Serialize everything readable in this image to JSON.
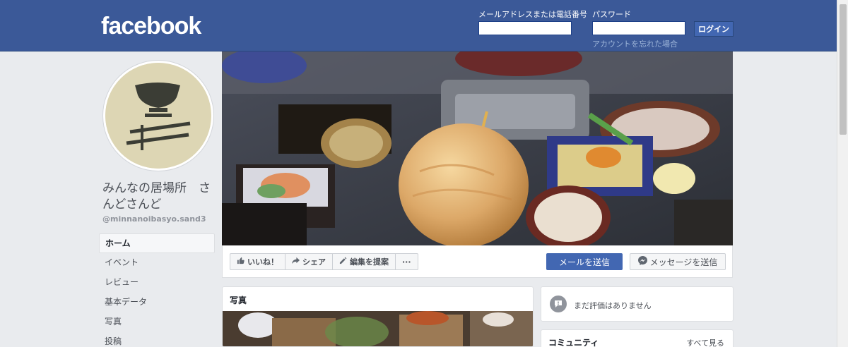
{
  "header": {
    "logo": "facebook",
    "email_label": "メールアドレスまたは電話番号",
    "password_label": "パスワード",
    "login_button": "ログイン",
    "forgot_link": "アカウントを忘れた場合",
    "brand_color": "#3b5998"
  },
  "profile": {
    "name": "みんなの居場所　さんどさんど",
    "handle": "@minnanoibasyo.sand3"
  },
  "nav": {
    "items": [
      {
        "label": "ホーム",
        "active": true
      },
      {
        "label": "イベント"
      },
      {
        "label": "レビュー"
      },
      {
        "label": "基本データ"
      },
      {
        "label": "写真"
      },
      {
        "label": "投稿"
      }
    ]
  },
  "actions": {
    "like": "いいね！",
    "share": "シェア",
    "suggest_edit": "編集を提案",
    "more": "···",
    "send_email": "メールを送信",
    "send_message": "メッセージを送信"
  },
  "photos": {
    "title": "写真"
  },
  "reviews": {
    "text": "まだ評価はありません"
  },
  "community": {
    "title": "コミュニティ",
    "see_all": "すべて見る"
  }
}
